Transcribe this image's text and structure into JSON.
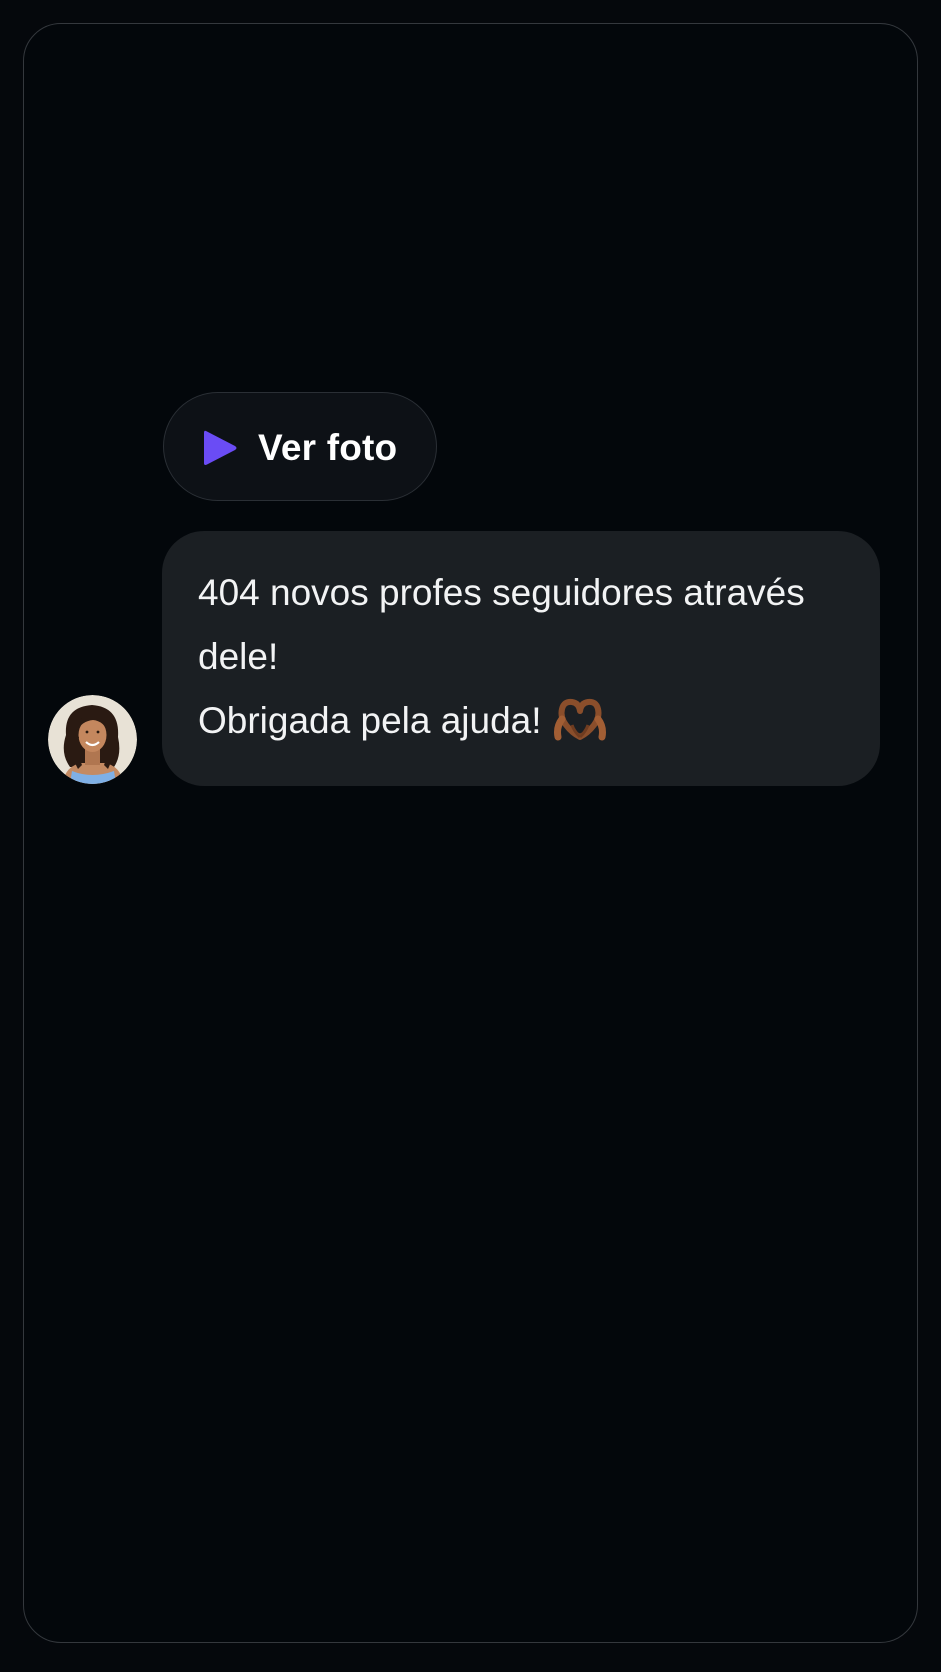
{
  "photo_button": {
    "label": "Ver foto",
    "icon": "play-icon",
    "icon_color": "#6a4cf5"
  },
  "message": {
    "line1": "404 novos profes seguidores através",
    "line2": "dele!",
    "line3": "Obrigada pela ajuda!",
    "emoji": "heart-hands-emoji"
  },
  "avatar": {
    "icon": "user-avatar"
  },
  "colors": {
    "background": "#03070b",
    "bubble": "#1b1f23",
    "accent": "#6a4cf5"
  }
}
